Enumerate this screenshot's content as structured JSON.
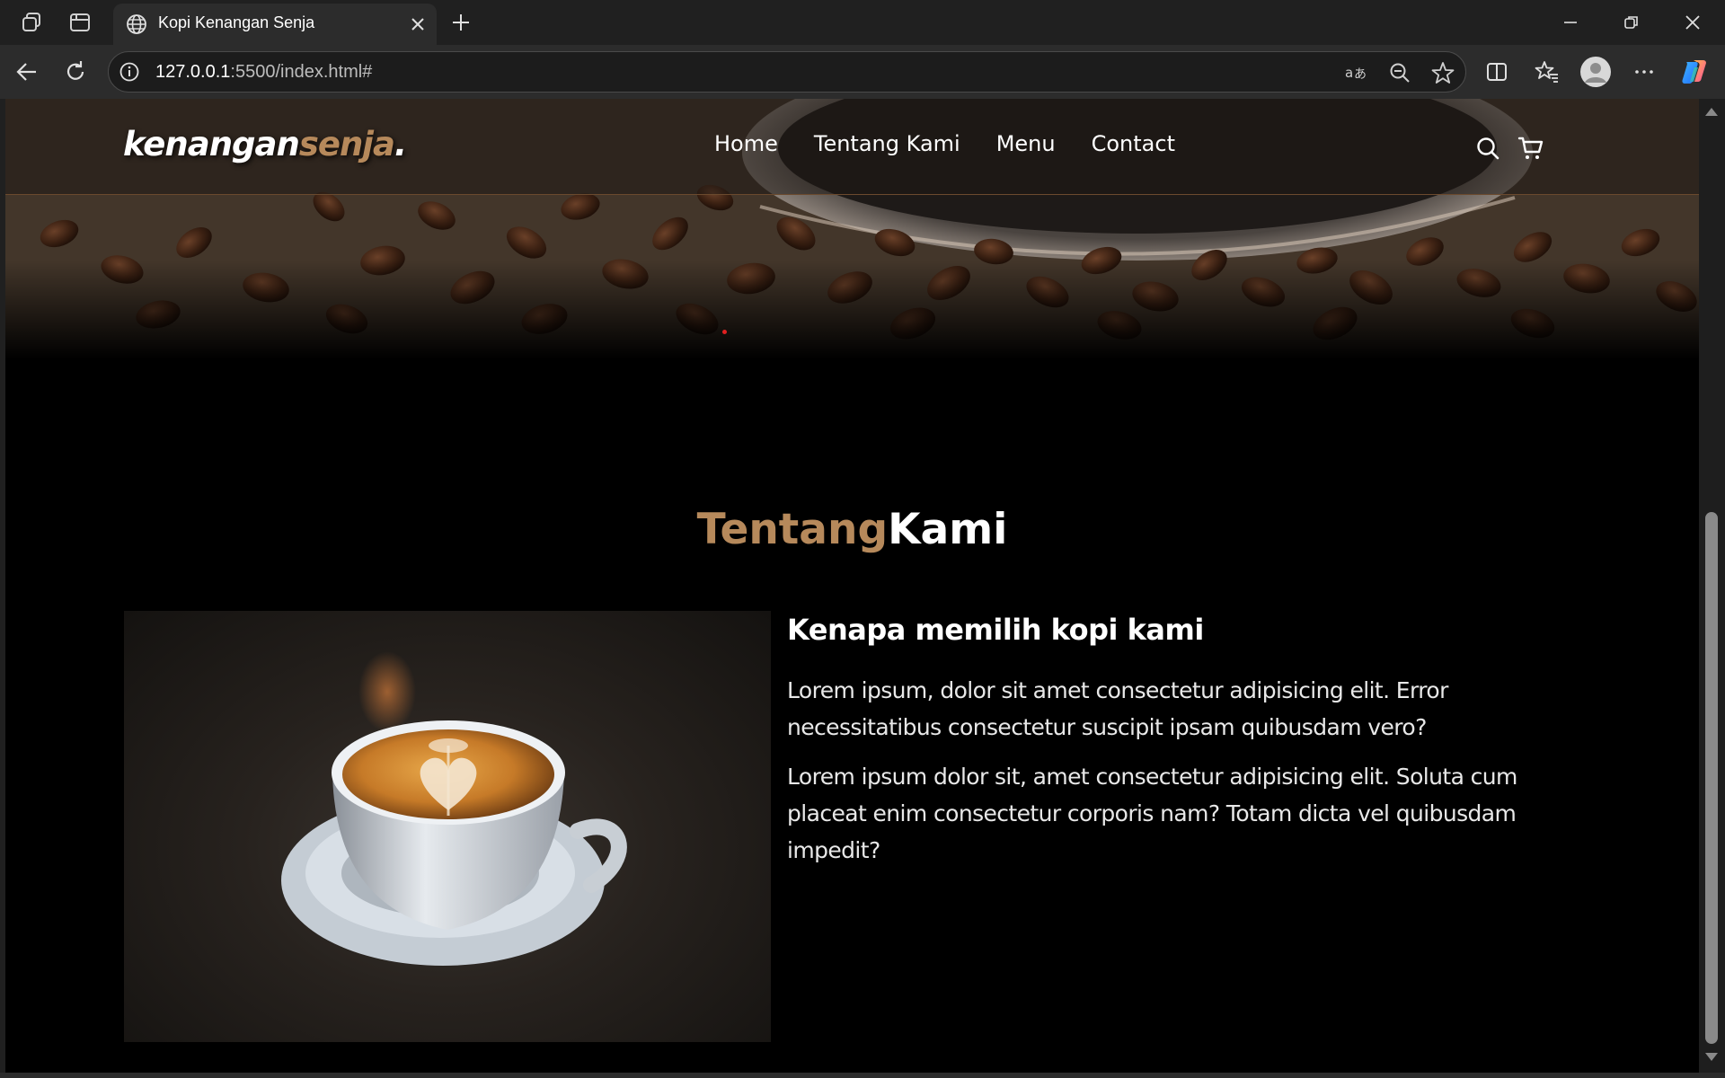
{
  "browser": {
    "tab_title": "Kopi Kenangan Senja",
    "url_host": "127.0.0.1",
    "url_rest": ":5500/index.html#",
    "icons": [
      "workspaces-icon",
      "tab-actions-icon",
      "globe-icon",
      "close-icon",
      "new-tab-icon",
      "minimize-icon",
      "restore-icon",
      "window-close-icon",
      "back-icon",
      "refresh-icon",
      "site-info-icon",
      "read-aloud-icon",
      "zoom-out-icon",
      "favorite-star-icon",
      "split-screen-icon",
      "favorites-icon",
      "profile-icon",
      "more-icon",
      "copilot-icon"
    ]
  },
  "site": {
    "logo_main": "kenangan",
    "logo_accent": "senja",
    "logo_dot": ".",
    "nav": [
      "Home",
      "Tentang Kami",
      "Menu",
      "Contact"
    ],
    "nav_icons": [
      "search-icon",
      "shopping-cart-icon"
    ],
    "accent_color": "#b6895b"
  },
  "about": {
    "title_accent": "Tentang",
    "title_main": "Kami",
    "heading": "Kenapa memilih kopi kami",
    "paragraph_1": "Lorem ipsum, dolor sit amet consectetur adipisicing elit. Error necessitatibus consectetur suscipit ipsam quibusdam vero?",
    "paragraph_2": "Lorem ipsum dolor sit, amet consectetur adipisicing elit. Soluta cum placeat enim consectetur corporis nam? Totam dicta vel quibusdam impedit?"
  }
}
